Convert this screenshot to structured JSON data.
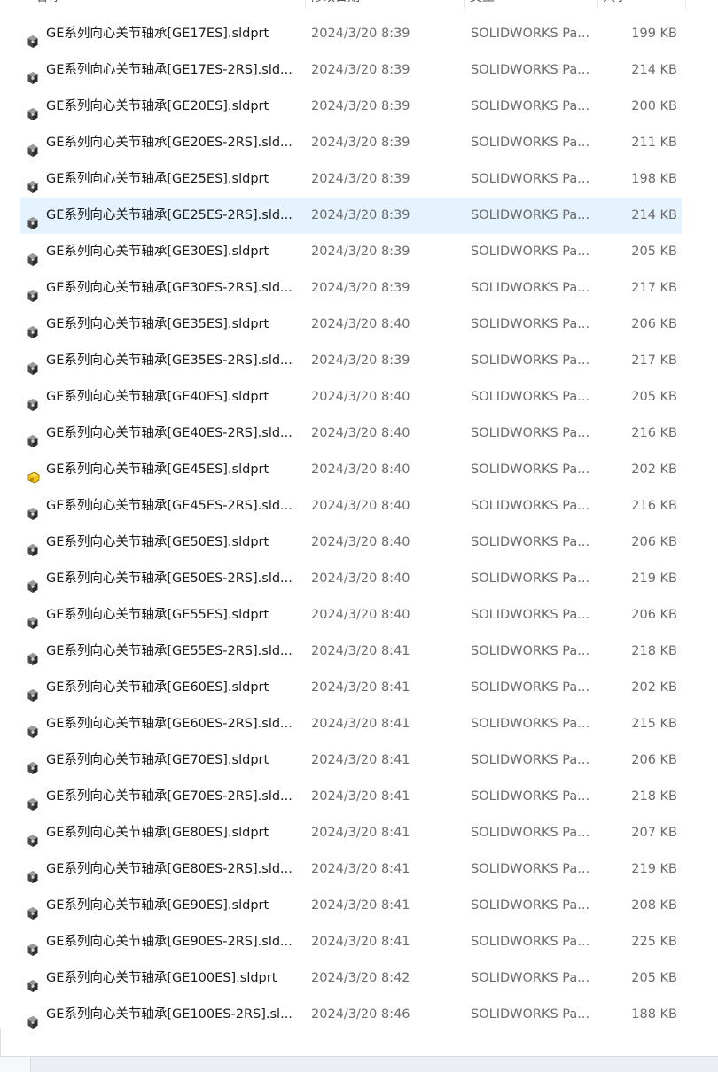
{
  "columns": {
    "name": "名称",
    "date": "修改日期",
    "type": "类型",
    "size": "大小"
  },
  "selected_index": 5,
  "special_icon_index": 12,
  "files": [
    {
      "name": "GE系列向心关节轴承[GE17ES].sldprt",
      "date": "2024/3/20 8:39",
      "type": "SOLIDWORKS Pa...",
      "size": "199 KB"
    },
    {
      "name": "GE系列向心关节轴承[GE17ES-2RS].sld...",
      "date": "2024/3/20 8:39",
      "type": "SOLIDWORKS Pa...",
      "size": "214 KB"
    },
    {
      "name": "GE系列向心关节轴承[GE20ES].sldprt",
      "date": "2024/3/20 8:39",
      "type": "SOLIDWORKS Pa...",
      "size": "200 KB"
    },
    {
      "name": "GE系列向心关节轴承[GE20ES-2RS].sld...",
      "date": "2024/3/20 8:39",
      "type": "SOLIDWORKS Pa...",
      "size": "211 KB"
    },
    {
      "name": "GE系列向心关节轴承[GE25ES].sldprt",
      "date": "2024/3/20 8:39",
      "type": "SOLIDWORKS Pa...",
      "size": "198 KB"
    },
    {
      "name": "GE系列向心关节轴承[GE25ES-2RS].sld...",
      "date": "2024/3/20 8:39",
      "type": "SOLIDWORKS Pa...",
      "size": "214 KB"
    },
    {
      "name": "GE系列向心关节轴承[GE30ES].sldprt",
      "date": "2024/3/20 8:39",
      "type": "SOLIDWORKS Pa...",
      "size": "205 KB"
    },
    {
      "name": "GE系列向心关节轴承[GE30ES-2RS].sld...",
      "date": "2024/3/20 8:39",
      "type": "SOLIDWORKS Pa...",
      "size": "217 KB"
    },
    {
      "name": "GE系列向心关节轴承[GE35ES].sldprt",
      "date": "2024/3/20 8:40",
      "type": "SOLIDWORKS Pa...",
      "size": "206 KB"
    },
    {
      "name": "GE系列向心关节轴承[GE35ES-2RS].sld...",
      "date": "2024/3/20 8:39",
      "type": "SOLIDWORKS Pa...",
      "size": "217 KB"
    },
    {
      "name": "GE系列向心关节轴承[GE40ES].sldprt",
      "date": "2024/3/20 8:40",
      "type": "SOLIDWORKS Pa...",
      "size": "205 KB"
    },
    {
      "name": "GE系列向心关节轴承[GE40ES-2RS].sld...",
      "date": "2024/3/20 8:40",
      "type": "SOLIDWORKS Pa...",
      "size": "216 KB"
    },
    {
      "name": "GE系列向心关节轴承[GE45ES].sldprt",
      "date": "2024/3/20 8:40",
      "type": "SOLIDWORKS Pa...",
      "size": "202 KB"
    },
    {
      "name": "GE系列向心关节轴承[GE45ES-2RS].sld...",
      "date": "2024/3/20 8:40",
      "type": "SOLIDWORKS Pa...",
      "size": "216 KB"
    },
    {
      "name": "GE系列向心关节轴承[GE50ES].sldprt",
      "date": "2024/3/20 8:40",
      "type": "SOLIDWORKS Pa...",
      "size": "206 KB"
    },
    {
      "name": "GE系列向心关节轴承[GE50ES-2RS].sld...",
      "date": "2024/3/20 8:40",
      "type": "SOLIDWORKS Pa...",
      "size": "219 KB"
    },
    {
      "name": "GE系列向心关节轴承[GE55ES].sldprt",
      "date": "2024/3/20 8:40",
      "type": "SOLIDWORKS Pa...",
      "size": "206 KB"
    },
    {
      "name": "GE系列向心关节轴承[GE55ES-2RS].sld...",
      "date": "2024/3/20 8:41",
      "type": "SOLIDWORKS Pa...",
      "size": "218 KB"
    },
    {
      "name": "GE系列向心关节轴承[GE60ES].sldprt",
      "date": "2024/3/20 8:41",
      "type": "SOLIDWORKS Pa...",
      "size": "202 KB"
    },
    {
      "name": "GE系列向心关节轴承[GE60ES-2RS].sld...",
      "date": "2024/3/20 8:41",
      "type": "SOLIDWORKS Pa...",
      "size": "215 KB"
    },
    {
      "name": "GE系列向心关节轴承[GE70ES].sldprt",
      "date": "2024/3/20 8:41",
      "type": "SOLIDWORKS Pa...",
      "size": "206 KB"
    },
    {
      "name": "GE系列向心关节轴承[GE70ES-2RS].sld...",
      "date": "2024/3/20 8:41",
      "type": "SOLIDWORKS Pa...",
      "size": "218 KB"
    },
    {
      "name": "GE系列向心关节轴承[GE80ES].sldprt",
      "date": "2024/3/20 8:41",
      "type": "SOLIDWORKS Pa...",
      "size": "207 KB"
    },
    {
      "name": "GE系列向心关节轴承[GE80ES-2RS].sld...",
      "date": "2024/3/20 8:41",
      "type": "SOLIDWORKS Pa...",
      "size": "219 KB"
    },
    {
      "name": "GE系列向心关节轴承[GE90ES].sldprt",
      "date": "2024/3/20 8:41",
      "type": "SOLIDWORKS Pa...",
      "size": "208 KB"
    },
    {
      "name": "GE系列向心关节轴承[GE90ES-2RS].sld...",
      "date": "2024/3/20 8:41",
      "type": "SOLIDWORKS Pa...",
      "size": "225 KB"
    },
    {
      "name": "GE系列向心关节轴承[GE100ES].sldprt",
      "date": "2024/3/20 8:42",
      "type": "SOLIDWORKS Pa...",
      "size": "205 KB"
    },
    {
      "name": "GE系列向心关节轴承[GE100ES-2RS].sl...",
      "date": "2024/3/20 8:46",
      "type": "SOLIDWORKS Pa...",
      "size": "188 KB"
    }
  ],
  "colors": {
    "selected_row": "#e5f3ff",
    "text_primary": "#1a1a1a",
    "text_secondary": "#6b6b6b",
    "special_icon": "#f5c518"
  }
}
